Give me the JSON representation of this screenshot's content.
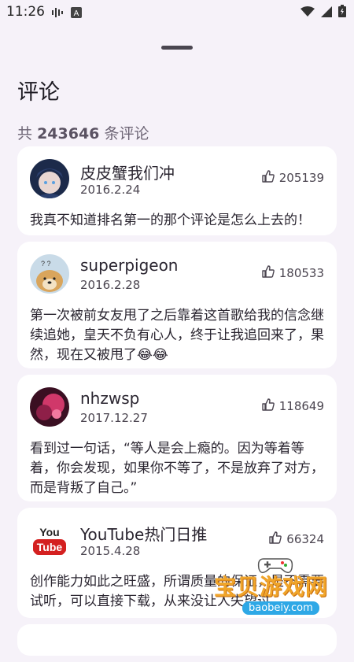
{
  "status_bar": {
    "time": "11:26"
  },
  "sheet": {
    "title": "评论",
    "count_prefix": "共",
    "count_value": "243646",
    "count_suffix": "条评论"
  },
  "comments": [
    {
      "username": "皮皮蟹我们冲",
      "date": "2016.2.24",
      "likes": "205139",
      "text": "我真不知道排名第一的那个评论是怎么上去的！",
      "avatar_icon": "anime-avatar-icon"
    },
    {
      "username": "superpigeon",
      "date": "2016.2.28",
      "likes": "180533",
      "text": "第一次被前女友甩了之后靠着这首歌给我的信念继续追她，皇天不负有心人，终于让我追回来了，果然，现在又被甩了😂😂",
      "avatar_icon": "doge-avatar-icon"
    },
    {
      "username": "nhzwsp",
      "date": "2017.12.27",
      "likes": "118649",
      "text": "看到过一句话，“等人是会上瘾的。因为等着等着，你会发现，如果你不等了，不是放弃了对方，而是背叛了自己。”",
      "avatar_icon": "pink-avatar-icon"
    },
    {
      "username": "YouTube热门日推",
      "date": "2015.4.28",
      "likes": "66324",
      "text": "创作能力如此之旺盛，所谓质量的保证，是不需要试听，可以直接下载，从来没让人失望过。",
      "avatar_icon": "youtube-logo-icon"
    }
  ],
  "avatar_text": {
    "youtube": "YouTube"
  },
  "watermark": {
    "text": "宝贝游戏网",
    "url": "baobeiy.com"
  }
}
